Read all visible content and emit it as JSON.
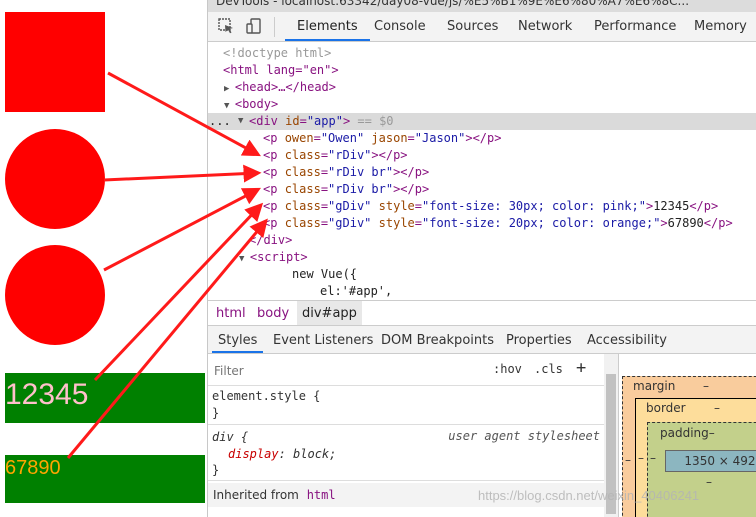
{
  "page": {
    "box1_text": "12345",
    "box2_text": "67890",
    "box1_color": "#ffc0cb",
    "box2_color": "#ffa500",
    "shape_color": "#ff0000",
    "bar_color": "#008000"
  },
  "devtools": {
    "window_title": "DevTools - localhost:63342/day08-vue/js/%E5%B1%9E%E6%80%A7%E6%8C...",
    "tabs": [
      "Elements",
      "Console",
      "Sources",
      "Network",
      "Performance",
      "Memory"
    ],
    "active_tab": "Elements",
    "tree": {
      "doctype": "<!doctype html>",
      "html_open": "<html lang=\"en\">",
      "head": "<head>…</head>",
      "body_open": "<body>",
      "div_open_tag": "<div",
      "div_attr_name": "id",
      "div_attr_value": "\"app\"",
      "div_close_bracket": ">",
      "div_suffix": " == $0",
      "dots": "...",
      "p1_prefix": "<p ",
      "p1_attr1_name": "owen",
      "p1_attr1_value": "\"Owen\"",
      "p1_attr2_name": "jason",
      "p1_attr2_value": "\"Jason\"",
      "p1_suffix": "></p>",
      "p_open": "<p ",
      "class_attr": "class",
      "style_attr": "style",
      "p2_class": "\"rDiv\"",
      "p3_class": "\"rDiv br\"",
      "p4_class": "\"rDiv br\"",
      "p5_class": "\"gDiv\"",
      "p5_style": "\"font-size: 30px; color: pink;\"",
      "p5_text": "12345",
      "p6_class": "\"gDiv\"",
      "p6_style": "\"font-size: 20px; color: orange;\"",
      "p6_text": "67890",
      "p_empty_close": "></p>",
      "gt": ">",
      "p_close": "</p>",
      "div_close": "</div>",
      "script_open": "<script>",
      "js_line1": "new Vue({",
      "js_line2": "el:'#app',"
    },
    "breadcrumb": [
      "html",
      "body",
      "div#app"
    ],
    "subtabs": [
      "Styles",
      "Event Listeners",
      "DOM Breakpoints",
      "Properties",
      "Accessibility"
    ],
    "filter_placeholder": "Filter",
    "hov": ":hov",
    "cls": ".cls",
    "plus": "+",
    "element_style": "element.style {",
    "close_brace": "}",
    "div_selector": "div {",
    "ua_label": "user agent stylesheet",
    "display_prop": "display",
    "display_value": ": block;",
    "inherited_from": "Inherited from",
    "inherited_tag": "html",
    "box_model": {
      "margin": "margin",
      "margin_value": "–",
      "border": "border",
      "border_value": "–",
      "padding": "padding–",
      "content": "1350 × 492",
      "dash": "–"
    },
    "watermark": "https://blog.csdn.net/weixin_40406241"
  }
}
